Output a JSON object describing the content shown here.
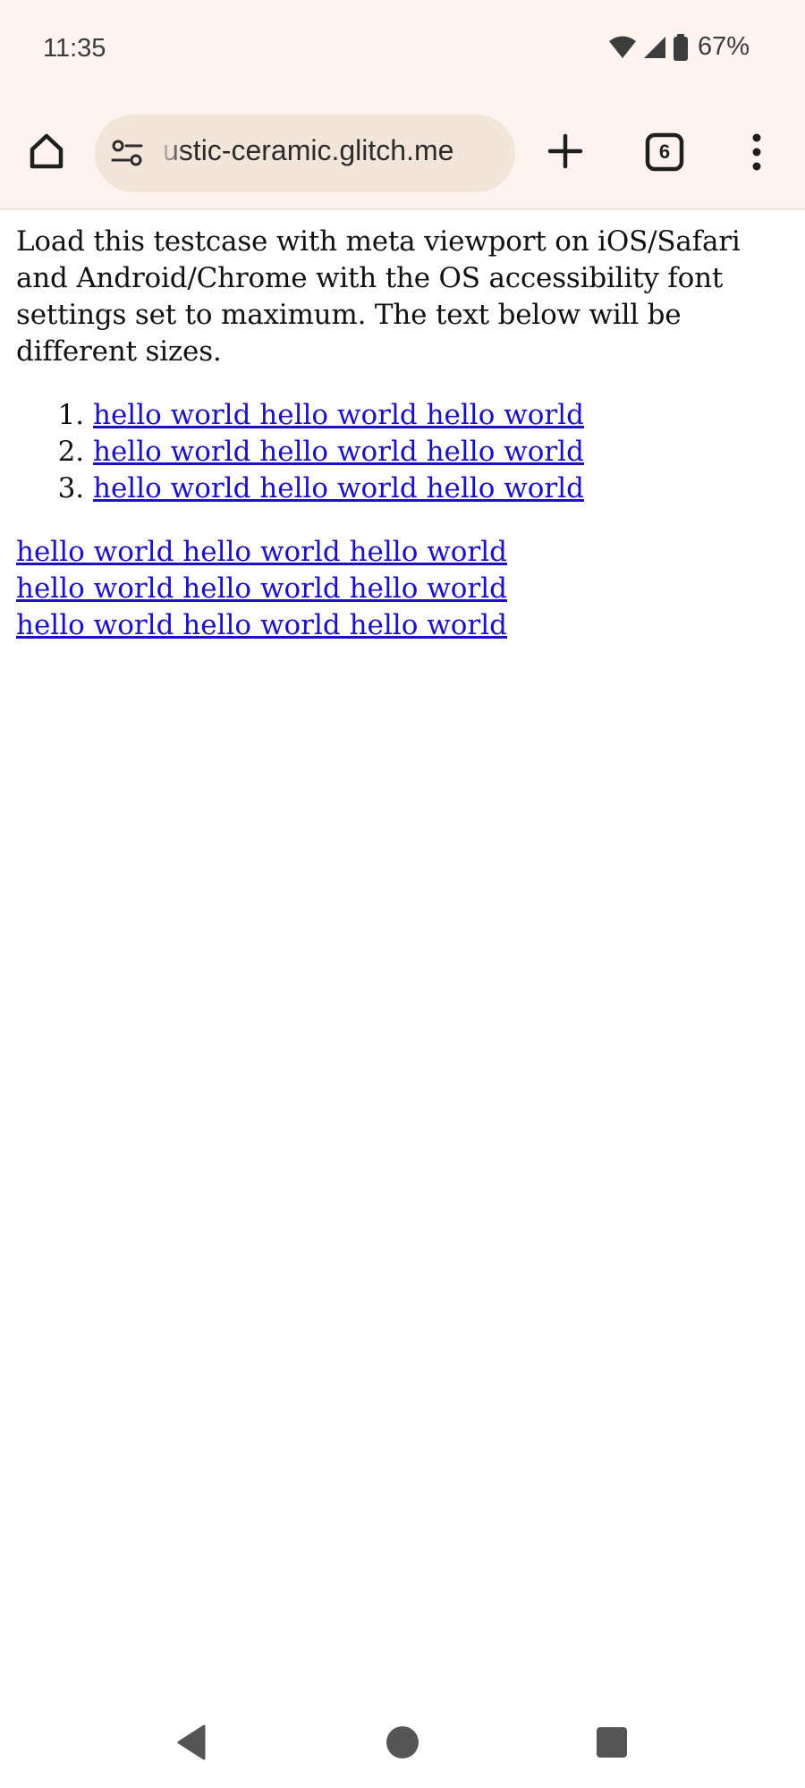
{
  "status_bar": {
    "time": "11:35",
    "battery_percent": "67%",
    "icons": [
      "wifi-icon",
      "signal-icon",
      "battery-icon"
    ]
  },
  "browser": {
    "url": "ustic-ceramic.glitch.me",
    "tab_count": "6",
    "icons": [
      "home-icon",
      "site-settings-icon",
      "new-tab-icon",
      "tab-switcher-icon",
      "more-menu-icon"
    ]
  },
  "page": {
    "intro": "Load this testcase with meta viewport on iOS/Safari and Android/Chrome with the OS accessibility font settings set to maximum. The text below will be different sizes.",
    "list_items": [
      "hello world hello world hello world",
      "hello world hello world hello world",
      "hello world hello world hello world"
    ],
    "plain_links": [
      "hello world hello world hello world",
      "hello world hello world hello world",
      "hello world hello world hello world"
    ]
  },
  "nav_bar": {
    "icons": [
      "back-icon",
      "home-circle-icon",
      "recents-icon"
    ]
  },
  "colors": {
    "chrome_background": "#fdf3f1",
    "url_pill": "#f2e6da",
    "link": "#1c10c6"
  }
}
